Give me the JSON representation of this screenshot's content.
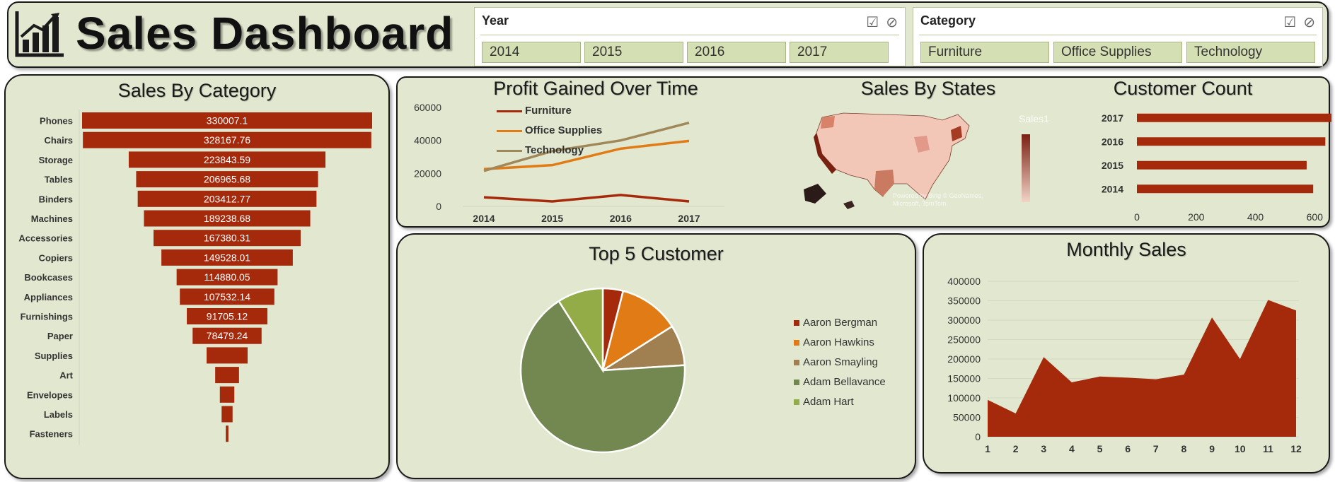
{
  "header": {
    "title": "Sales Dashboard",
    "year_slicer": {
      "label": "Year",
      "items": [
        "2014",
        "2015",
        "2016",
        "2017"
      ]
    },
    "category_slicer": {
      "label": "Category",
      "items": [
        "Furniture",
        "Office Supplies",
        "Technology"
      ]
    }
  },
  "panels": {
    "sales_by_category": "Sales By Category",
    "profit_over_time": "Profit Gained Over Time",
    "sales_by_states": "Sales By States",
    "customer_count": "Customer Count",
    "top5_customer": "Top 5 Customer",
    "monthly_sales": "Monthly Sales"
  },
  "map": {
    "legend_label": "Sales1",
    "attribution": "Powered by Bing © GeoNames, Microsoft, TomTom"
  },
  "colors": {
    "bar": "#a52a0c",
    "panel": "#e2e8d0",
    "furniture": "#a52a0c",
    "office": "#e07b16",
    "tech": "#a08858",
    "pie": [
      "#a52a0c",
      "#e07b16",
      "#a08050",
      "#728850",
      "#94ac48"
    ]
  },
  "chart_data": [
    {
      "id": "sales_by_category",
      "type": "bar",
      "title": "Sales By Category",
      "categories": [
        "Phones",
        "Chairs",
        "Storage",
        "Tables",
        "Binders",
        "Machines",
        "Accessories",
        "Copiers",
        "Bookcases",
        "Appliances",
        "Furnishings",
        "Paper",
        "Supplies",
        "Art",
        "Envelopes",
        "Labels",
        "Fasteners"
      ],
      "values": [
        330007.1,
        328167.76,
        223843.59,
        206965.68,
        203412.77,
        189238.68,
        167380.31,
        149528.01,
        114880.05,
        107532.14,
        91705.12,
        78479.24,
        46673.54,
        27118.79,
        16476.4,
        12486.31,
        3024.28
      ],
      "value_labels": [
        "330007.1",
        "328167.76",
        "223843.59",
        "206965.68",
        "203412.77",
        "189238.68",
        "167380.31",
        "149528.01",
        "114880.05",
        "107532.14",
        "91705.12",
        "78479.24",
        "",
        "",
        "",
        "",
        ""
      ]
    },
    {
      "id": "profit_over_time",
      "type": "line",
      "title": "Profit Gained Over Time",
      "x": [
        "2014",
        "2015",
        "2016",
        "2017"
      ],
      "ylim": [
        0,
        60000
      ],
      "yticks": [
        0,
        20000,
        40000,
        60000
      ],
      "series": [
        {
          "name": "Furniture",
          "values": [
            5500,
            3000,
            6900,
            3000
          ]
        },
        {
          "name": "Office Supplies",
          "values": [
            22600,
            25000,
            35000,
            39700
          ]
        },
        {
          "name": "Technology",
          "values": [
            21500,
            33500,
            40000,
            50700
          ]
        }
      ]
    },
    {
      "id": "customer_count",
      "type": "bar",
      "title": "Customer Count",
      "categories": [
        "2017",
        "2016",
        "2015",
        "2014"
      ],
      "values": [
        693,
        636,
        573,
        595
      ],
      "xlim": [
        0,
        800
      ],
      "xticks": [
        0,
        200,
        400,
        600,
        800
      ]
    },
    {
      "id": "top5_customer",
      "type": "pie",
      "title": "Top 5 Customer",
      "labels": [
        "Aaron Bergman",
        "Aaron Hawkins",
        "Aaron Smayling",
        "Adam Bellavance",
        "Adam Hart"
      ],
      "values": [
        4,
        12,
        8,
        67,
        9
      ]
    },
    {
      "id": "monthly_sales",
      "type": "area",
      "title": "Monthly Sales",
      "x": [
        1,
        2,
        3,
        4,
        5,
        6,
        7,
        8,
        9,
        10,
        11,
        12
      ],
      "values": [
        95000,
        60000,
        205000,
        140000,
        155000,
        152000,
        148000,
        160000,
        307000,
        200000,
        352000,
        325000
      ],
      "ylim": [
        0,
        400000
      ],
      "yticks": [
        0,
        50000,
        100000,
        150000,
        200000,
        250000,
        300000,
        350000,
        400000
      ]
    }
  ]
}
